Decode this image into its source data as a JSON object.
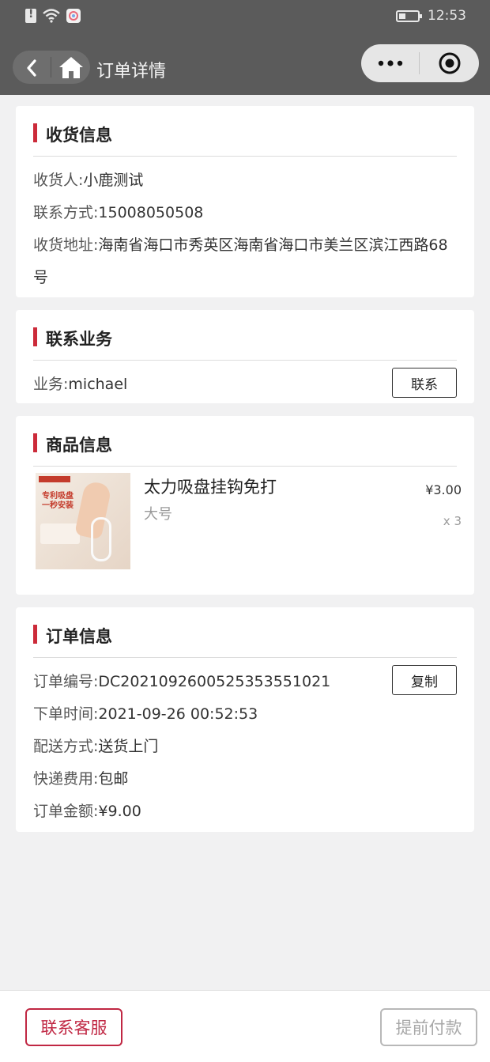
{
  "status_bar": {
    "time": "12:53"
  },
  "nav": {
    "title": "订单详情"
  },
  "shipping": {
    "title": "收货信息",
    "receiver_label": "收货人:",
    "receiver": "小鹿测试",
    "phone_label": "联系方式:",
    "phone": "15008050508",
    "address_label": "收货地址:",
    "address": "海南省海口市秀英区海南省海口市美兰区滨江西路68号"
  },
  "sales": {
    "title": "联系业务",
    "label": "业务:",
    "name": "michael",
    "contact_button": "联系"
  },
  "product": {
    "title": "商品信息",
    "name": "太力吸盘挂钩免打",
    "spec": "大号",
    "price": "¥3.00",
    "quantity": "x 3",
    "thumb_text": "专利吸盘\n一秒安装"
  },
  "order": {
    "title": "订单信息",
    "number_label": "订单编号:",
    "number": "DC2021092600525353551021",
    "copy_button": "复制",
    "time_label": "下单时间:",
    "time": "2021-09-26 00:52:53",
    "delivery_label": "配送方式:",
    "delivery": "送货上门",
    "shipping_fee_label": "快递费用:",
    "shipping_fee": "包邮",
    "amount_label": "订单金额:",
    "amount": "¥9.00"
  },
  "footer": {
    "customer_service": "联系客服",
    "prepay": "提前付款"
  },
  "colors": {
    "accent_red": "#cc2b3a",
    "button_red": "#c02743",
    "header_gray": "#5b5b5b"
  }
}
